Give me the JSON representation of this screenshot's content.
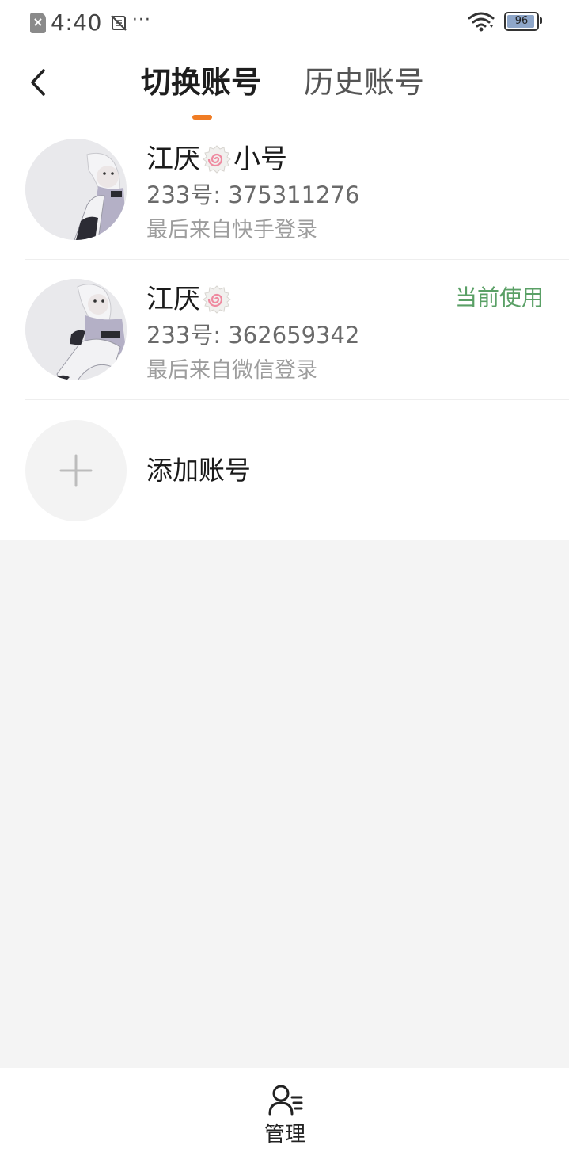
{
  "status_bar": {
    "time": "4:40",
    "more": "···",
    "battery": "96"
  },
  "header": {
    "tabs": [
      {
        "label": "切换账号",
        "active": true
      },
      {
        "label": "历史账号",
        "active": false
      }
    ],
    "accent": "#f07c24"
  },
  "accounts": [
    {
      "name_prefix": "江厌",
      "name_suffix": "小号",
      "badge_icon": "narutomaki-icon",
      "id_text": "233号: 375311276",
      "source": "最后来自快手登录",
      "current": ""
    },
    {
      "name_prefix": "江厌",
      "name_suffix": "",
      "badge_icon": "narutomaki-icon",
      "id_text": "233号: 362659342",
      "source": "最后来自微信登录",
      "current": "当前使用"
    }
  ],
  "add_account": {
    "label": "添加账号"
  },
  "bottom_bar": {
    "manage_label": "管理"
  },
  "colors": {
    "current_green": "#5aa066",
    "page_bg": "#f4f4f4"
  }
}
